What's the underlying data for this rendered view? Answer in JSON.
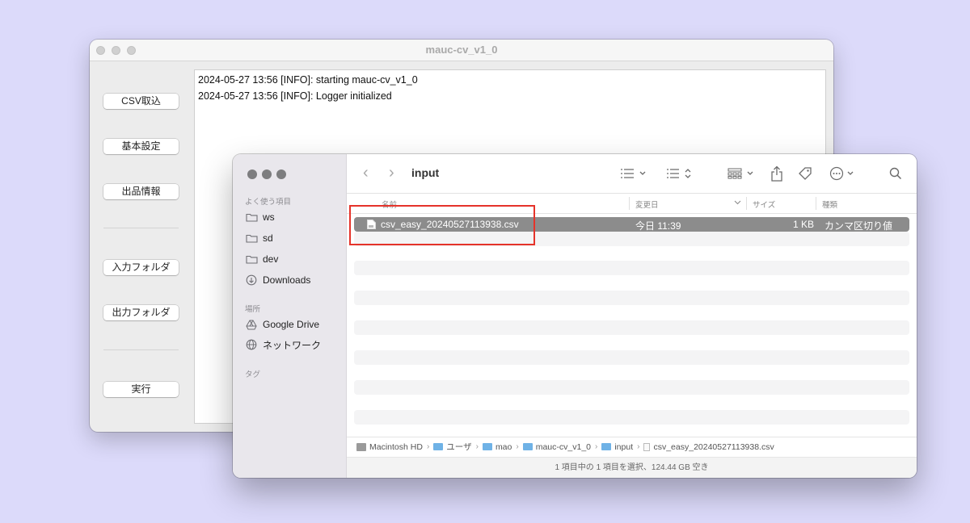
{
  "app": {
    "title": "mauc-cv_v1_0",
    "buttons": {
      "csv_import": "CSV取込",
      "basic_settings": "基本設定",
      "product_info": "出品情報",
      "input_folder": "入力フォルダ",
      "output_folder": "出力フォルダ",
      "run": "実行"
    },
    "log_lines": [
      "2024-05-27 13:56 [INFO]: starting mauc-cv_v1_0",
      "2024-05-27 13:56 [INFO]: Logger initialized"
    ]
  },
  "finder": {
    "title": "input",
    "sidebar": {
      "favorites_header": "よく使う項目",
      "favorites": [
        "ws",
        "sd",
        "dev",
        "Downloads"
      ],
      "locations_header": "場所",
      "locations": [
        "Google Drive",
        "ネットワーク"
      ],
      "tags_header": "タグ"
    },
    "columns": {
      "name": "名前",
      "modified": "変更日",
      "size": "サイズ",
      "kind": "種類"
    },
    "files": [
      {
        "name": "csv_easy_20240527113938.csv",
        "modified": "今日 11:39",
        "size": "1 KB",
        "kind": "カンマ区切り値"
      }
    ],
    "path": [
      "Macintosh HD",
      "ユーザ",
      "mao",
      "mauc-cv_v1_0",
      "input",
      "csv_easy_20240527113938.csv"
    ],
    "status": "1 項目中の 1 項目を選択、124.44 GB 空き"
  },
  "colors": {
    "desktop": "#dcdafa",
    "selection": "#8c8c8c",
    "highlight_box": "#e5332a",
    "folder": "#6fb2e6"
  }
}
